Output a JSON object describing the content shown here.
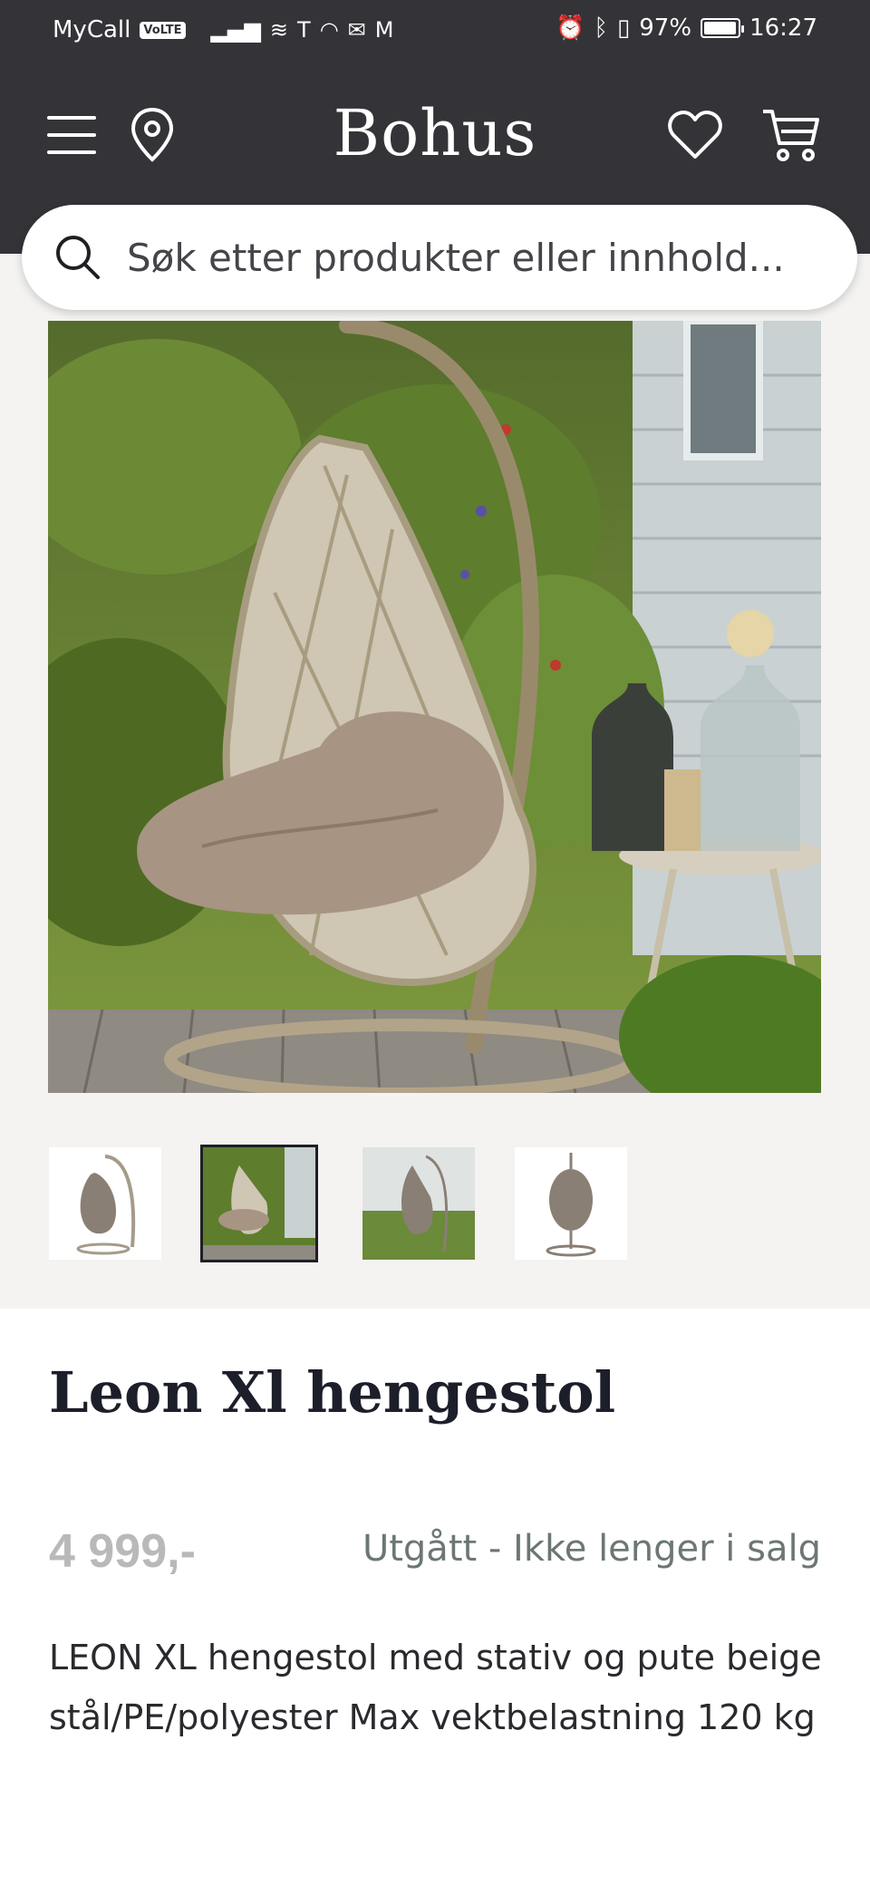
{
  "status_bar": {
    "carrier": "MyCall",
    "network_badge": "VoLTE",
    "battery_percent": "97%",
    "battery_level": 0.97,
    "time": "16:27",
    "icons": [
      "signal-icon",
      "wifi-icon",
      "tesla-icon",
      "wifi-hotspot-icon",
      "mail-icon",
      "gmail-icon",
      "alarm-icon",
      "bluetooth-icon",
      "vibrate-icon"
    ]
  },
  "header": {
    "logo": "Bohus",
    "icons": [
      "menu-icon",
      "location-pin-icon",
      "heart-icon",
      "cart-icon"
    ],
    "background_color": "#333338"
  },
  "search": {
    "placeholder": "Søk etter produkter eller innhold..."
  },
  "gallery": {
    "thumbnail_count": 4,
    "active_thumbnail_index": 1
  },
  "product": {
    "title": "Leon Xl hengestol",
    "price": "4 999,-",
    "availability": "Utgått - Ikke lenger i salg",
    "description": "LEON XL hengestol med stativ og pute beige stål/PE/polyester Max vektbelastning 120 kg"
  }
}
